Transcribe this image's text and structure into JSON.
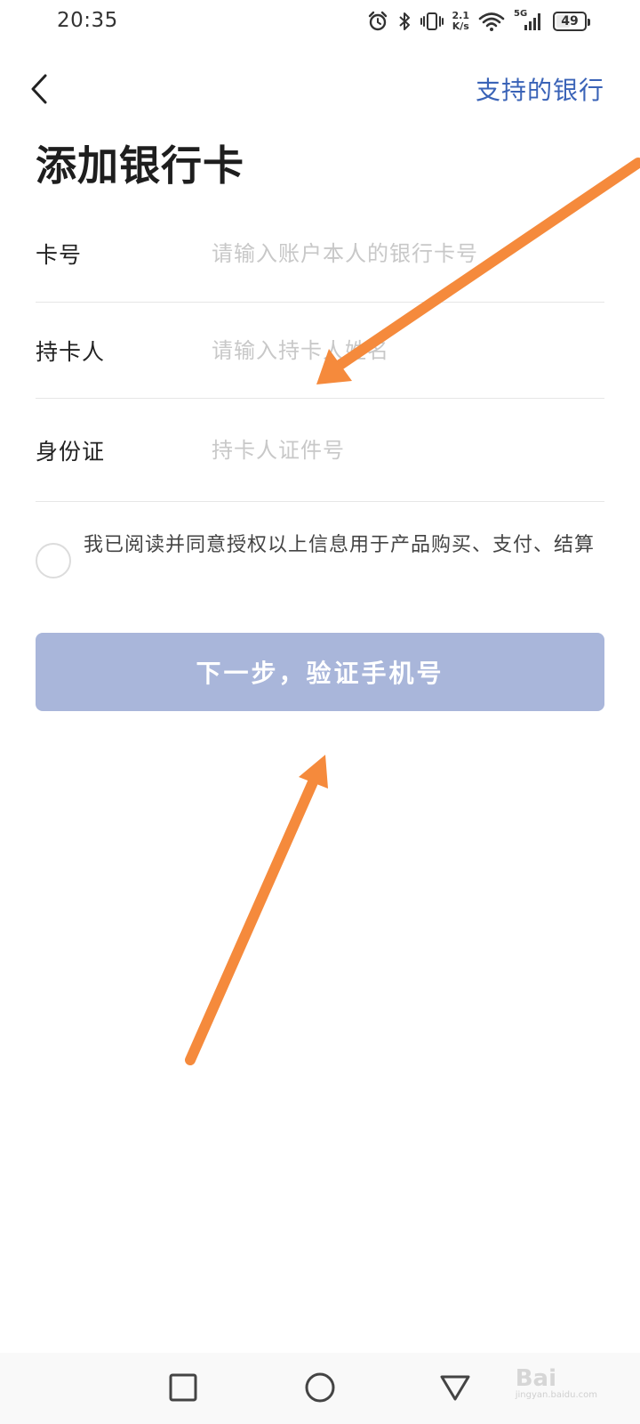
{
  "status_bar": {
    "time": "20:35",
    "net_speed_value": "2.1",
    "net_speed_unit": "K/s",
    "network_type": "5G",
    "battery_level": "49",
    "icons": [
      "alarm-icon",
      "bluetooth-icon",
      "vibrate-icon",
      "wifi-icon",
      "signal-icon",
      "battery-icon"
    ]
  },
  "nav": {
    "back_icon": "chevron-left-icon",
    "supported_banks": "支持的银行"
  },
  "page_title": "添加银行卡",
  "form": {
    "card_number": {
      "label": "卡号",
      "placeholder": "请输入账户本人的银行卡号",
      "value": ""
    },
    "holder": {
      "label": "持卡人",
      "placeholder": "请输入持卡人姓名",
      "value": ""
    },
    "id_card": {
      "label": "身份证",
      "placeholder": "持卡人证件号",
      "value": ""
    }
  },
  "agreement": {
    "checked": false,
    "text": "我已阅读并同意授权以上信息用于产品购买、支付、结算"
  },
  "next_button": {
    "label": "下一步，验证手机号"
  },
  "colors": {
    "accent_link": "#3a63b7",
    "button_disabled": "#a9b6da",
    "annotation_arrow": "#f58a3c"
  },
  "system_nav": {
    "items": [
      "recents-square-icon",
      "home-circle-icon",
      "back-triangle-icon"
    ]
  },
  "watermark": {
    "brand": "Bai",
    "subtitle": "jingyan.baidu.com"
  }
}
